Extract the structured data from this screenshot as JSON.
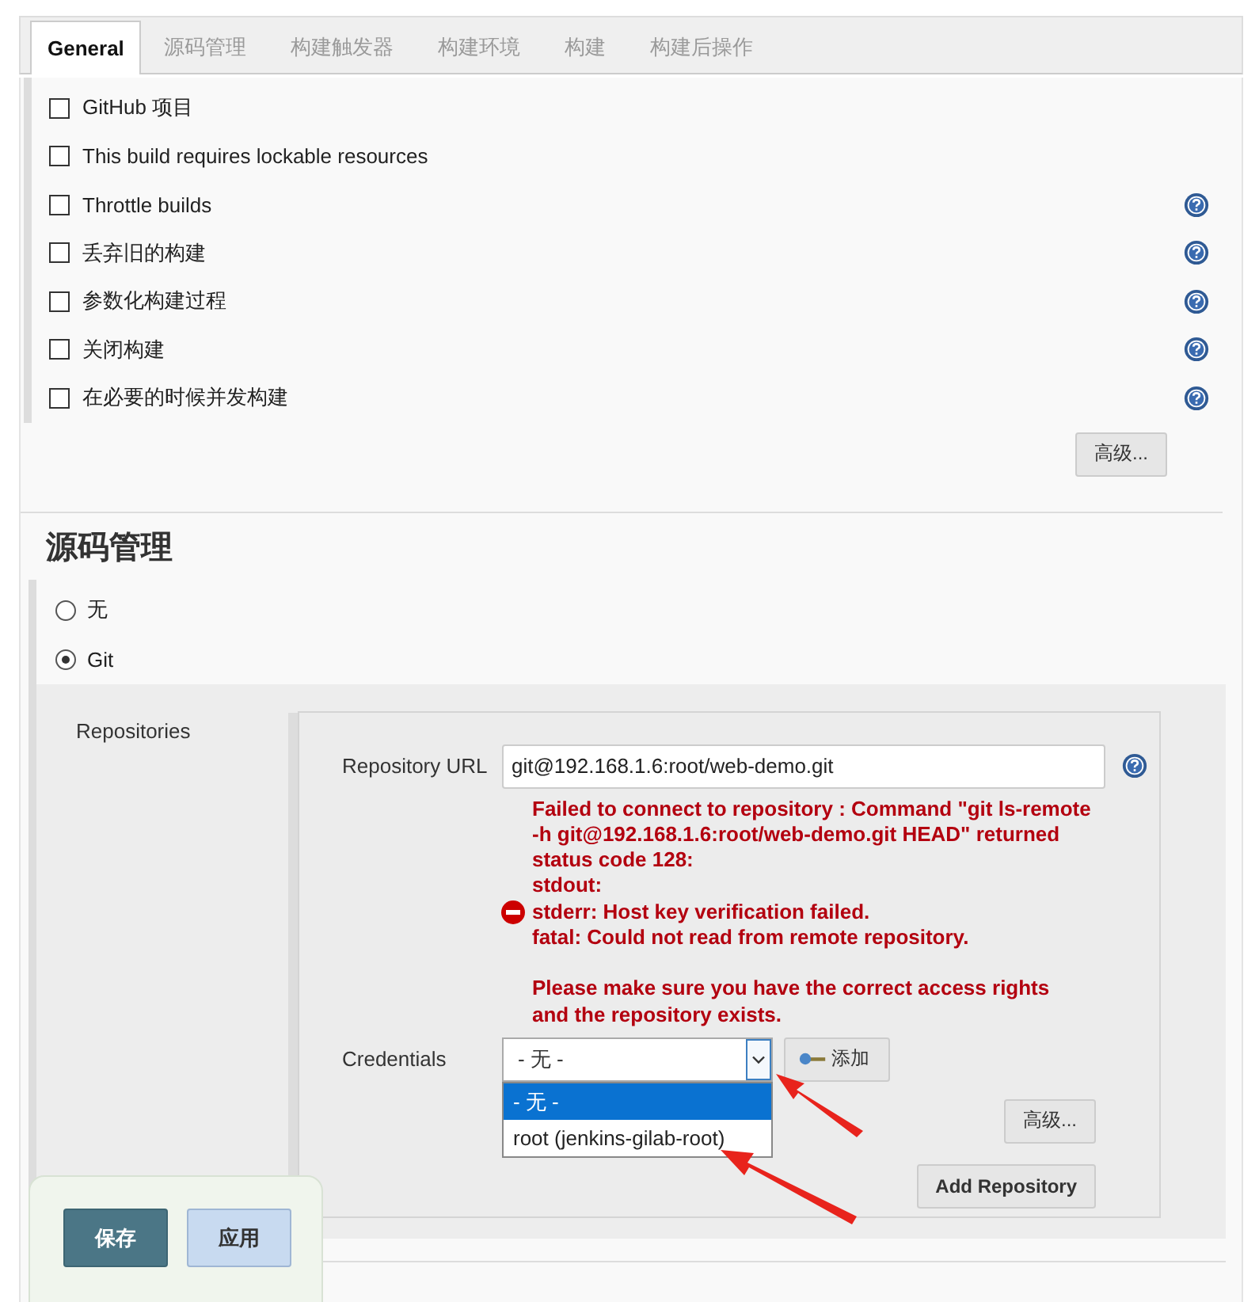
{
  "tabs": [
    {
      "label": "General",
      "selected": true
    },
    {
      "label": "源码管理",
      "selected": false
    },
    {
      "label": "构建触发器",
      "selected": false
    },
    {
      "label": "构建环境",
      "selected": false
    },
    {
      "label": "构建",
      "selected": false
    },
    {
      "label": "构建后操作",
      "selected": false
    }
  ],
  "options": [
    {
      "label": "GitHub 项目",
      "checked": false,
      "help": false
    },
    {
      "label": "This build requires lockable resources",
      "checked": false,
      "help": false
    },
    {
      "label": "Throttle builds",
      "checked": false,
      "help": true
    },
    {
      "label": "丢弃旧的构建",
      "checked": false,
      "help": true
    },
    {
      "label": "参数化构建过程",
      "checked": false,
      "help": true
    },
    {
      "label": "关闭构建",
      "checked": false,
      "help": true
    },
    {
      "label": "在必要的时候并发构建",
      "checked": false,
      "help": true
    }
  ],
  "advanced_button": "高级...",
  "scm": {
    "heading": "源码管理",
    "radios": [
      {
        "label": "无",
        "selected": false
      },
      {
        "label": "Git",
        "selected": true
      }
    ],
    "repositories": {
      "label": "Repositories",
      "url": {
        "label": "Repository URL",
        "value": "git@192.168.1.6:root/web-demo.git"
      },
      "error": [
        [
          "Failed to connect to repository : Command \"git ls-remote",
          "-h git@192.168.1.6:root/web-demo.git HEAD\" returned",
          "status code 128:",
          "stdout:",
          "stderr: Host key verification failed.",
          "fatal: Could not read from remote repository."
        ],
        [
          "Please make sure you have the correct access rights",
          "and the repository exists."
        ]
      ],
      "credentials": {
        "label": "Credentials",
        "value": "- 无 -",
        "add_button": "添加",
        "options": [
          {
            "label": "- 无 -",
            "selected": true
          },
          {
            "label": "root (jenkins-gilab-root)",
            "selected": false
          }
        ]
      },
      "advanced_button": "高级...",
      "add_repository_button": "Add Repository"
    }
  },
  "footer_buttons": [
    {
      "label": "保存",
      "kind": "primary"
    },
    {
      "label": "应用",
      "kind": "secondary"
    }
  ]
}
